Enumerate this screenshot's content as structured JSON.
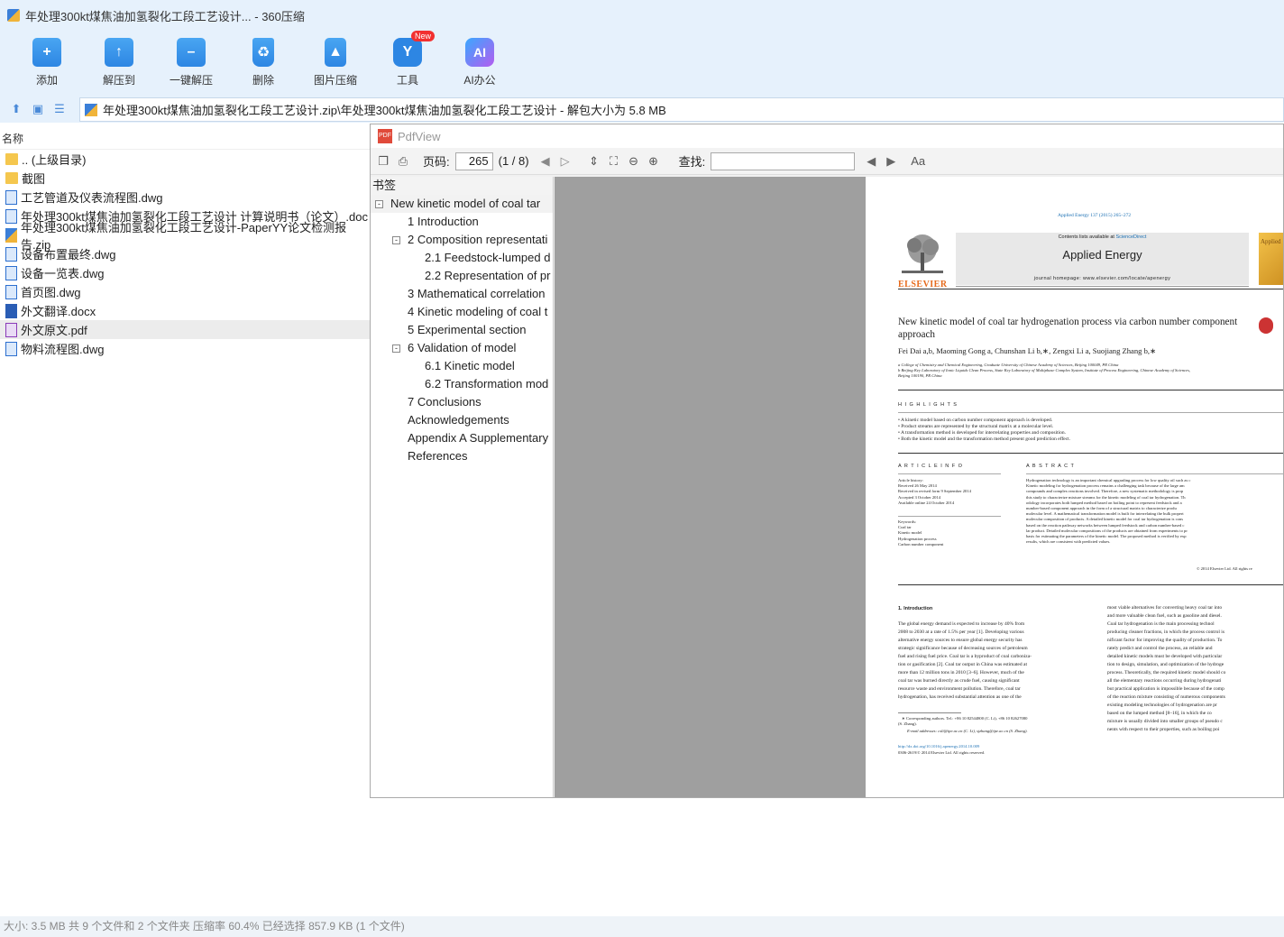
{
  "window": {
    "title": "年处理300kt煤焦油加氢裂化工段工艺设计... - 360压缩"
  },
  "toolbar": {
    "buttons": [
      {
        "label": "添加",
        "icon": "add-icon"
      },
      {
        "label": "解压到",
        "icon": "extract-to-icon"
      },
      {
        "label": "一键解压",
        "icon": "one-click-extract-icon"
      },
      {
        "label": "删除",
        "icon": "delete-icon"
      },
      {
        "label": "图片压缩",
        "icon": "image-compress-icon"
      },
      {
        "label": "工具",
        "icon": "tools-icon",
        "badge": "New"
      },
      {
        "label": "AI办公",
        "icon": "ai-office-icon",
        "glyph": "AI"
      }
    ]
  },
  "address": {
    "path": "年处理300kt煤焦油加氢裂化工段工艺设计.zip\\年处理300kt煤焦油加氢裂化工段工艺设计 - 解包大小为 5.8 MB"
  },
  "filelist": {
    "column_name": "名称",
    "rows": [
      {
        "name": ".. (上级目录)",
        "type": "folder"
      },
      {
        "name": "截图",
        "type": "folder"
      },
      {
        "name": "工艺管道及仪表流程图.dwg",
        "type": "dwg"
      },
      {
        "name": "年处理300kt煤焦油加氢裂化工段工艺设计 计算说明书（论文）.doc",
        "type": "doc"
      },
      {
        "name": "年处理300kt煤焦油加氢裂化工段工艺设计-PaperYY论文检测报告.zip",
        "type": "zip"
      },
      {
        "name": "设备布置最终.dwg",
        "type": "dwg"
      },
      {
        "name": "设备一览表.dwg",
        "type": "dwg"
      },
      {
        "name": "首页图.dwg",
        "type": "dwg"
      },
      {
        "name": "外文翻译.docx",
        "type": "docx"
      },
      {
        "name": "外文原文.pdf",
        "type": "pdf",
        "selected": true
      },
      {
        "name": "物料流程图.dwg",
        "type": "dwg"
      }
    ]
  },
  "statusbar": {
    "text": "大小: 3.5 MB 共 9 个文件和 2 个文件夹 压缩率 60.4% 已经选择 857.9 KB (1 个文件)"
  },
  "pdfview": {
    "title": "PdfView",
    "page_label": "页码:",
    "page_value": "265",
    "page_total": "(1 / 8)",
    "find_label": "查找:",
    "find_value": "",
    "bookmarks_header": "书签",
    "bookmarks": [
      {
        "label": "New kinetic model of coal tar",
        "level": 0,
        "toggle": "-",
        "selected": true
      },
      {
        "label": "1 Introduction",
        "level": 1
      },
      {
        "label": "2 Composition representati",
        "level": 1,
        "toggle": "-"
      },
      {
        "label": "2.1 Feedstock-lumped d",
        "level": 2
      },
      {
        "label": "2.2 Representation of pr",
        "level": 2
      },
      {
        "label": "3 Mathematical correlation",
        "level": 1
      },
      {
        "label": "4 Kinetic modeling of coal t",
        "level": 1
      },
      {
        "label": "5 Experimental section",
        "level": 1
      },
      {
        "label": "6 Validation of model",
        "level": 1,
        "toggle": "-"
      },
      {
        "label": "6.1 Kinetic model",
        "level": 2
      },
      {
        "label": "6.2 Transformation mod",
        "level": 2
      },
      {
        "label": "7 Conclusions",
        "level": 1
      },
      {
        "label": "Acknowledgements",
        "level": 1
      },
      {
        "label": "Appendix A Supplementary",
        "level": 1
      },
      {
        "label": "References",
        "level": 1
      }
    ]
  },
  "paper": {
    "citation": "Applied Energy 137 (2015) 265–272",
    "contents_line_prefix": "Contents lists available at ",
    "contents_line_link": "ScienceDirect",
    "journal": "Applied Energy",
    "homepage": "journal homepage: www.elsevier.com/locate/apenergy",
    "publisher": "ELSEVIER",
    "cover_text": "Applied",
    "title": "New kinetic model of coal tar hydrogenation process via carbon number component approach",
    "authors": "Fei Dai a,b, Maoming Gong a, Chunshan Li b,∗, Zengxi Li a, Suojiang Zhang b,∗",
    "affil_a": "a College of Chemistry and Chemical Engineering, Graduate University of Chinese Academy of Sciences, Beijing 100049, PR China",
    "affil_b": "b Beijing Key Laboratory of Ionic Liquids Clean Process, State Key Laboratory of Multiphase Complex System, Institute of Process Engineering, Chinese Academy of Sciences,",
    "affil_b2": "Beijing 100190, PR China",
    "highlights_heading": "H I G H L I G H T S",
    "highlights": [
      "• A kinetic model based on carbon number component approach is developed.",
      "• Product streams are represented by the structural matrix at a molecular level.",
      "• A transformation method is developed for interrelating properties and composition.",
      "• Both the kinetic model and the transformation method present good prediction effect."
    ],
    "article_info_heading": "A R T I C L E   I N F O",
    "abstract_heading": "A B S T R A C T",
    "history": [
      "Article history:",
      "Received 26 May 2014",
      "Received in revised form 9 September 2014",
      "Accepted 3 October 2014",
      "Available online 24 October 2014"
    ],
    "keywords": [
      "Keywords:",
      "Coal tar",
      "Kinetic model",
      "Hydrogenation process",
      "Carbon number component"
    ],
    "abstract_lines": [
      "Hydrogenation technology is an important chemical upgrading process for low quality oil such as c",
      "Kinetic modeling for hydrogenation process remains a challenging task because of the large am",
      "compounds and complex reactions involved. Therefore, a new systematic methodology is prop",
      "this study to characterize mixture streams for the kinetic modeling of coal tar hydrogenation. Th",
      "odology incorporates both lumped method based on boiling point to represent feedstock and a",
      "number-based component approach in the form of a structural matrix to characterize produ",
      "molecular level. A mathematical transformation model is built for interrelating the bulk propert",
      "molecular composition of products. A detailed kinetic model for coal tar hydrogenation is cons",
      "based on the reaction pathway networks between lumped feedstock and carbon number-based c",
      "lar product. Detailed molecular compositions of the products are obtained from experiments to pr",
      "basis for estimating the parameters of the kinetic model. The proposed method is verified by exp",
      "results, which are consistent with predicted values."
    ],
    "copyright": "© 2014 Elsevier Ltd. All rights re",
    "intro_heading": "1. Introduction",
    "intro_left": [
      "The global energy demand is expected to increase by 40% from",
      "2008 to 2030 at a rate of 1.5% per year [1]. Developing various",
      "alternative energy sources to ensure global energy security has",
      "strategic significance because of decreasing sources of petroleum",
      "fuel and rising fuel price. Coal tar is a byproduct of coal carboniza-",
      "tion or gasification [2]. Coal tar output in China was estimated at",
      "more than 12 million tons in 2010 [3–6]. However, much of the",
      "coal tar was burned directly as crude fuel, causing significant",
      "resource waste and environment pollution. Therefore, coal tar",
      "hydrogenation, has received substantial attention as one of the"
    ],
    "intro_right": [
      "most viable alternatives for converting heavy coal tar into",
      "and more valuable clean fuel, such as gasoline and diesel.",
      "Coal tar hydrogenation is the main processing technol",
      "producing cleaner fractions, in which the process control is",
      "nificant factor for improving the quality of production. To",
      "rately predict and control the process, an reliable and",
      "detailed kinetic models must be developed with particular",
      "tion to design, simulation, and optimization of the hydroge",
      "process. Theoretically, the required kinetic model should co",
      "all the elementary reactions occurring during hydrogenati",
      "but practical application is impossible because of the comp",
      "of the reaction mixture consisting of numerous components",
      "existing modeling technologies of hydrogenation are pr",
      "based on the lumped method [8–16], in which the co",
      "mixture is usually divided into smaller groups of pseudo c",
      "nents with respect to their properties, such as boiling poi"
    ],
    "footnote1": "∗ Corresponding authors. Tel.: +86 10 82544800 (C. Li), +86 10 82627080",
    "footnote1b": "(S. Zhang).",
    "footnote2": "E-mail addresses: csli@ipe.ac.cn (C. Li), sjzhang@ipe.ac.cn (S. Zhang).",
    "doi": "http://dx.doi.org/10.1016/j.apenergy.2014.10.009",
    "issn": "0306-2619/© 2014 Elsevier Ltd. All rights reserved."
  },
  "colors": {
    "toolbar_bg": "#e6f1fc",
    "accent_blue": "#2d86e3",
    "link_blue": "#1a6fb3",
    "elsevier_orange": "#e66a1c"
  }
}
